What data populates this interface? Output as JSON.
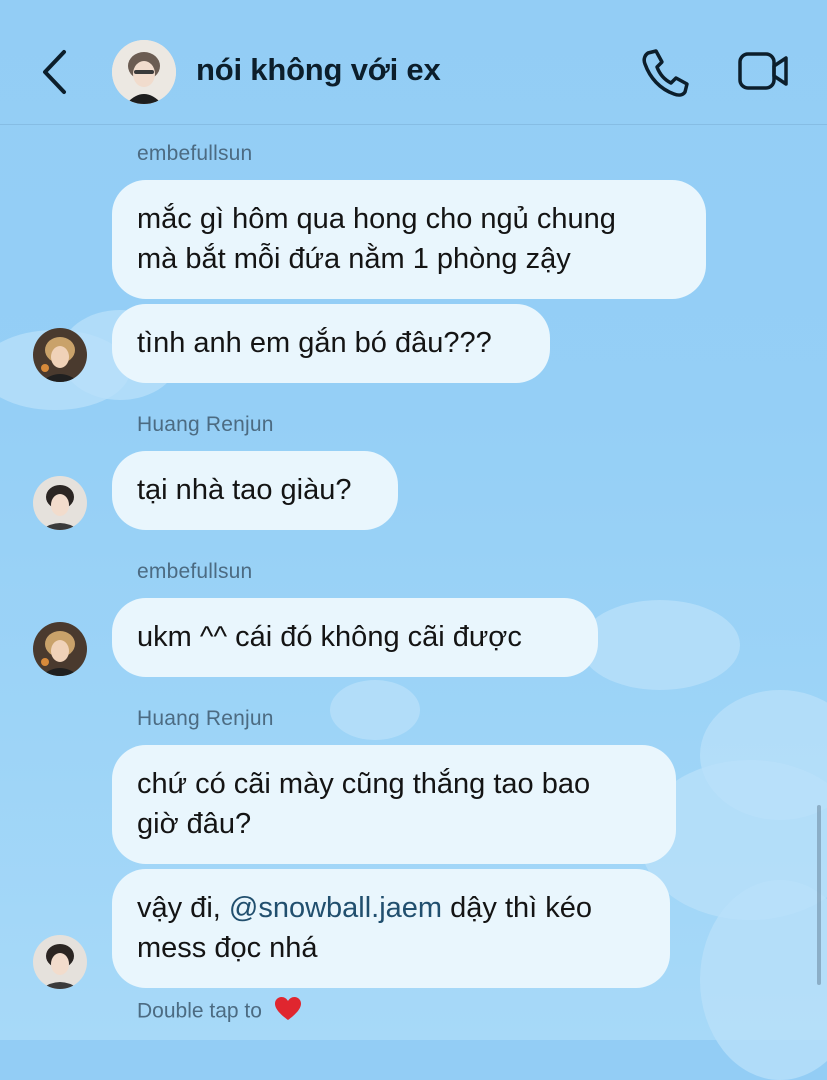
{
  "header": {
    "title": "nói không với ex",
    "back_icon": "chevron-left-icon",
    "call_icon": "phone-icon",
    "video_icon": "video-camera-icon"
  },
  "messages": [
    {
      "sender": "embefullsun",
      "text": "mắc gì hôm qua hong cho ngủ chung\nmà bắt mỗi đứa nằm 1 phòng zậy"
    },
    {
      "text": "tình anh em gắn bó đâu???"
    },
    {
      "sender": "Huang Renjun",
      "text": "tại nhà tao giàu?"
    },
    {
      "sender": "embefullsun",
      "text": "ukm ^^ cái đó không cãi được"
    },
    {
      "sender": "Huang Renjun",
      "text": "chứ có cãi mày cũng thắng tao bao\ngiờ đâu?"
    },
    {
      "text_before": "vậy đi, ",
      "mention": "@snowball.jaem",
      "text_after": " dậy thì kéo\nmess đọc nhá"
    }
  ],
  "footer": {
    "double_tap": "Double tap to",
    "heart_icon": "red-heart-icon"
  },
  "colors": {
    "background": "#93cdf5",
    "bubble": "#e9f6fd",
    "mention": "#214f6e",
    "heart": "#e0262f"
  }
}
